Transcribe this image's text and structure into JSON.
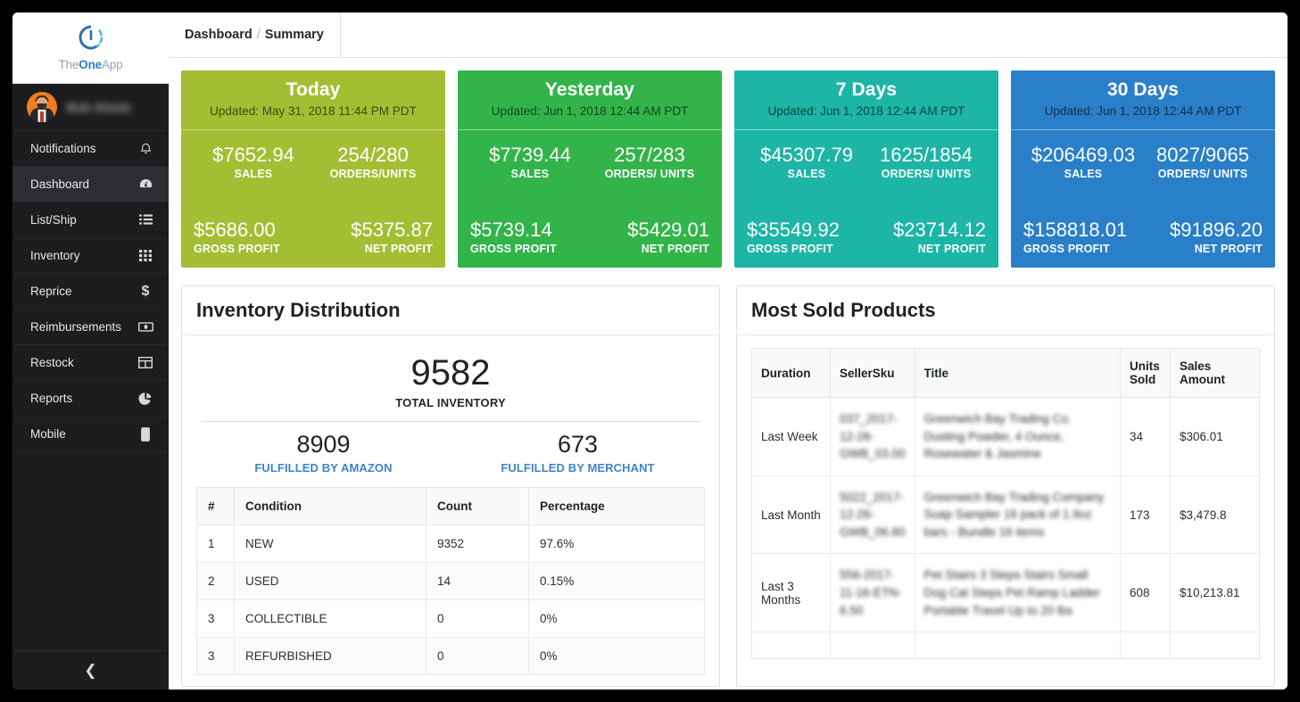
{
  "brand": {
    "logo_text_parts": [
      "The",
      "One",
      "App"
    ],
    "logo_icon": "circle-clock-icon",
    "accent_blue": "#2a7fc9"
  },
  "sidebar": {
    "user": {
      "name": "Bob Steele",
      "avatar_icon": "user-avatar"
    },
    "items": [
      {
        "label": "Notifications",
        "icon": "bell-icon",
        "active": false
      },
      {
        "label": "Dashboard",
        "icon": "speedometer-icon",
        "active": true
      },
      {
        "label": "List/Ship",
        "icon": "list-icon",
        "active": false
      },
      {
        "label": "Inventory",
        "icon": "grid-icon",
        "active": false
      },
      {
        "label": "Reprice",
        "icon": "dollar-icon",
        "active": false
      },
      {
        "label": "Reimbursements",
        "icon": "banknote-icon",
        "active": false
      },
      {
        "label": "Restock",
        "icon": "table-icon",
        "active": false
      },
      {
        "label": "Reports",
        "icon": "pie-chart-icon",
        "active": false
      },
      {
        "label": "Mobile",
        "icon": "phone-icon",
        "active": false
      }
    ],
    "collapse_icon": "chevron-left-icon"
  },
  "topbar": {
    "breadcrumb_root": "Dashboard",
    "breadcrumb_sep": "/",
    "breadcrumb_current": "Summary"
  },
  "cards": [
    {
      "title": "Today",
      "updated": "Updated: May 31, 2018 11:44 PM PDT",
      "color": "#a4be34",
      "sales_value": "$7652.94",
      "sales_label": "SALES",
      "orders_value": "254/280",
      "orders_label": "ORDERS/UNITS",
      "gross_value": "$5686.00",
      "gross_label": "GROSS PROFIT",
      "net_value": "$5375.87",
      "net_label": "NET PROFIT"
    },
    {
      "title": "Yesterday",
      "updated": "Updated: Jun 1, 2018 12:44 AM PDT",
      "color": "#33b44a",
      "sales_value": "$7739.44",
      "sales_label": "SALES",
      "orders_value": "257/283",
      "orders_label": "ORDERS/ UNITS",
      "gross_value": "$5739.14",
      "gross_label": "GROSS PROFIT",
      "net_value": "$5429.01",
      "net_label": "NET PROFIT"
    },
    {
      "title": "7 Days",
      "updated": "Updated: Jun 1, 2018 12:44 AM PDT",
      "color": "#1db5a6",
      "sales_value": "$45307.79",
      "sales_label": "SALES",
      "orders_value": "1625/1854",
      "orders_label": "ORDERS/ UNITS",
      "gross_value": "$35549.92",
      "gross_label": "GROSS PROFIT",
      "net_value": "$23714.12",
      "net_label": "NET PROFIT"
    },
    {
      "title": "30 Days",
      "updated": "Updated: Jun 1, 2018 12:44 AM PDT",
      "color": "#2a7fc9",
      "sales_value": "$206469.03",
      "sales_label": "SALES",
      "orders_value": "8027/9065",
      "orders_label": "ORDERS/ UNITS",
      "gross_value": "$158818.01",
      "gross_label": "GROSS PROFIT",
      "net_value": "$91896.20",
      "net_label": "NET PROFIT"
    }
  ],
  "inventory_panel": {
    "title": "Inventory Distribution",
    "total_value": "9582",
    "total_label": "TOTAL INVENTORY",
    "fba_value": "8909",
    "fba_label": "FULFILLED BY AMAZON",
    "fbm_value": "673",
    "fbm_label": "FULFILLED BY MERCHANT",
    "columns": [
      "#",
      "Condition",
      "Count",
      "Percentage"
    ],
    "rows": [
      {
        "num": "1",
        "condition": "NEW",
        "count": "9352",
        "percentage": "97.6%"
      },
      {
        "num": "2",
        "condition": "USED",
        "count": "14",
        "percentage": "0.15%"
      },
      {
        "num": "3",
        "condition": "COLLECTIBLE",
        "count": "0",
        "percentage": "0%"
      },
      {
        "num": "3",
        "condition": "REFURBISHED",
        "count": "0",
        "percentage": "0%"
      }
    ]
  },
  "most_sold_panel": {
    "title": "Most Sold Products",
    "columns": [
      "Duration",
      "SellerSku",
      "Title",
      "Units Sold",
      "Sales Amount"
    ],
    "rows": [
      {
        "duration": "Last Week",
        "sku": "037_2017-12-26-GWB_03.00",
        "title": "Greenwich Bay Trading Co. Dusting Powder, 4 Ounce, Rosewater & Jasmine",
        "units": "34",
        "amount": "$306.01"
      },
      {
        "duration": "Last Month",
        "sku": "5022_2017-12-26-GWB_06.80",
        "title": "Greenwich Bay Trading Company Soap Sampler 16 pack of 1.9oz bars - Bundle 16 items",
        "units": "173",
        "amount": "$3,479.8"
      },
      {
        "duration": "Last 3 Months",
        "sku": "556-2017-11-16-ETN-6.50",
        "title": "Pet Stairs 3 Steps Stairs Small Dog Cat Steps Pet Ramp Ladder Portable Travel Up to 20 lbs",
        "units": "608",
        "amount": "$10,213.81"
      }
    ]
  }
}
